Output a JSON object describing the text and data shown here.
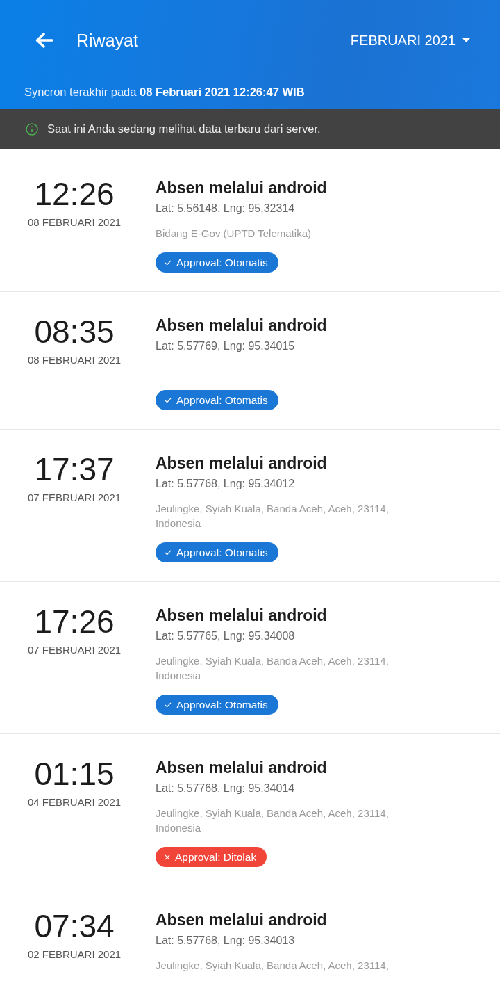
{
  "header": {
    "title": "Riwayat",
    "month_selector": "FEBRUARI 2021",
    "sync_text": "Syncron terakhir pada **08 Februari 2021 12:26:47 WIB**"
  },
  "notice": {
    "text": "Saat ini Anda sedang melihat data terbaru dari server."
  },
  "entries": [
    {
      "time": "12:26",
      "date": "08 FEBRUARI 2021",
      "title": "Absen melalui android",
      "coordinates": "Lat: 5.56148, Lng: 95.32314",
      "address": "Bidang E-Gov (UPTD Telematika)",
      "approval": {
        "kind": "approved",
        "label": "Approval: Otomatis"
      }
    },
    {
      "time": "08:35",
      "date": "08 FEBRUARI 2021",
      "title": "Absen melalui android",
      "coordinates": "Lat: 5.57769, Lng: 95.34015",
      "approval": {
        "kind": "approved",
        "label": "Approval: Otomatis"
      }
    },
    {
      "time": "17:37",
      "date": "07 FEBRUARI 2021",
      "title": "Absen melalui android",
      "coordinates": "Lat: 5.57768, Lng: 95.34012",
      "address": "Jeulingke, Syiah Kuala, Banda Aceh, Aceh, 23114, Indonesia",
      "approval": {
        "kind": "approved",
        "label": "Approval: Otomatis"
      }
    },
    {
      "time": "17:26",
      "date": "07 FEBRUARI 2021",
      "title": "Absen melalui android",
      "coordinates": "Lat: 5.57765, Lng: 95.34008",
      "address": "Jeulingke, Syiah Kuala, Banda Aceh, Aceh, 23114, Indonesia",
      "approval": {
        "kind": "approved",
        "label": "Approval: Otomatis"
      }
    },
    {
      "time": "01:15",
      "date": "04 FEBRUARI 2021",
      "title": "Absen melalui android",
      "coordinates": "Lat: 5.57768, Lng: 95.34014",
      "address": "Jeulingke, Syiah Kuala, Banda Aceh, Aceh, 23114, Indonesia",
      "approval": {
        "kind": "rejected",
        "label": "Approval: Ditolak"
      }
    },
    {
      "time": "07:34",
      "date": "02 FEBRUARI 2021",
      "title": "Absen melalui android",
      "coordinates": "Lat: 5.57768, Lng: 95.34013",
      "address": "Jeulingke, Syiah Kuala, Banda Aceh, Aceh, 23114,"
    }
  ]
}
